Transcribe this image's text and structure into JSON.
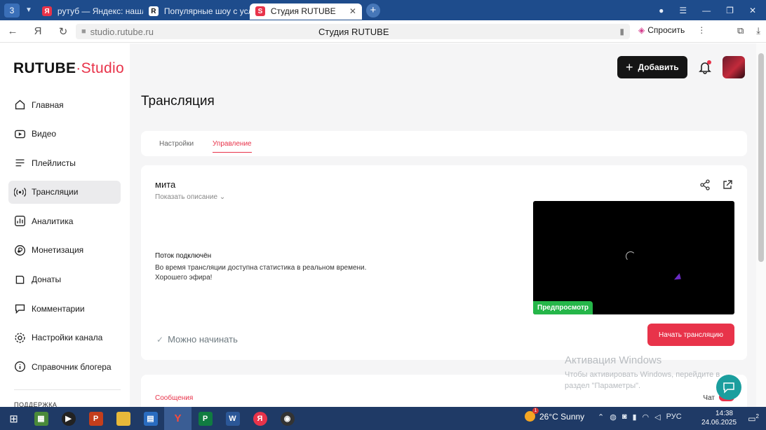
{
  "browser": {
    "tab_count": "3",
    "tabs": [
      {
        "label": "рутуб — Яндекс: нашлос",
        "icon": "yandex-icon",
        "color": "#e8334a"
      },
      {
        "label": "Популярные шоу с услуг",
        "icon": "rutube-icon",
        "color": "#111111"
      },
      {
        "label": "Студия RUTUBE",
        "icon": "rutube-studio-icon",
        "color": "#e8334a"
      }
    ],
    "url": "studio.rutube.ru",
    "page_title": "Студия RUTUBE",
    "ask_label": "Спросить"
  },
  "sidebar": {
    "logo_main": "RUTUBE",
    "logo_dot": "·",
    "logo_studio": "Studio",
    "items": [
      {
        "label": "Главная",
        "icon": "home-icon"
      },
      {
        "label": "Видео",
        "icon": "video-icon"
      },
      {
        "label": "Плейлисты",
        "icon": "playlist-icon"
      },
      {
        "label": "Трансляции",
        "icon": "broadcast-icon",
        "active": true
      },
      {
        "label": "Аналитика",
        "icon": "analytics-icon"
      },
      {
        "label": "Монетизация",
        "icon": "monetization-icon"
      },
      {
        "label": "Донаты",
        "icon": "donate-icon"
      },
      {
        "label": "Комментарии",
        "icon": "comments-icon"
      },
      {
        "label": "Настройки канала",
        "icon": "gear-icon"
      },
      {
        "label": "Справочник блогера",
        "icon": "help-icon"
      }
    ],
    "footer": "ПОДДЕРЖКА"
  },
  "header": {
    "add_label": "Добавить"
  },
  "main": {
    "title": "Трансляция",
    "tabs": [
      {
        "label": "Настройки"
      },
      {
        "label": "Управление",
        "selected": true
      }
    ],
    "stream": {
      "name": "мита",
      "show_description": "Показать описание",
      "preview_badge": "Предпросмотр",
      "status_title": "Поток подключён",
      "status_line1": "Во время трансляции доступна статистика в реальном времени.",
      "status_line2": "Хорошего эфира!",
      "ready_label": "Можно начинать",
      "start_button": "Начать трансляцию"
    },
    "messages": {
      "title": "Сообщения",
      "chat_label": "Чат",
      "chat_enabled": true
    }
  },
  "watermark": {
    "line1": "Активация Windows",
    "line2": "Чтобы активировать Windows, перейдите в",
    "line3": "раздел \"Параметры\"."
  },
  "taskbar": {
    "weather": "26°C  Sunny",
    "weather_badge": "1",
    "lang": "РУС",
    "time": "14:38",
    "date": "24.06.2025",
    "notif_count": "2"
  },
  "colors": {
    "accent": "#e8334a",
    "preview_badge": "#25b649",
    "chrome": "#1e4c8c"
  }
}
